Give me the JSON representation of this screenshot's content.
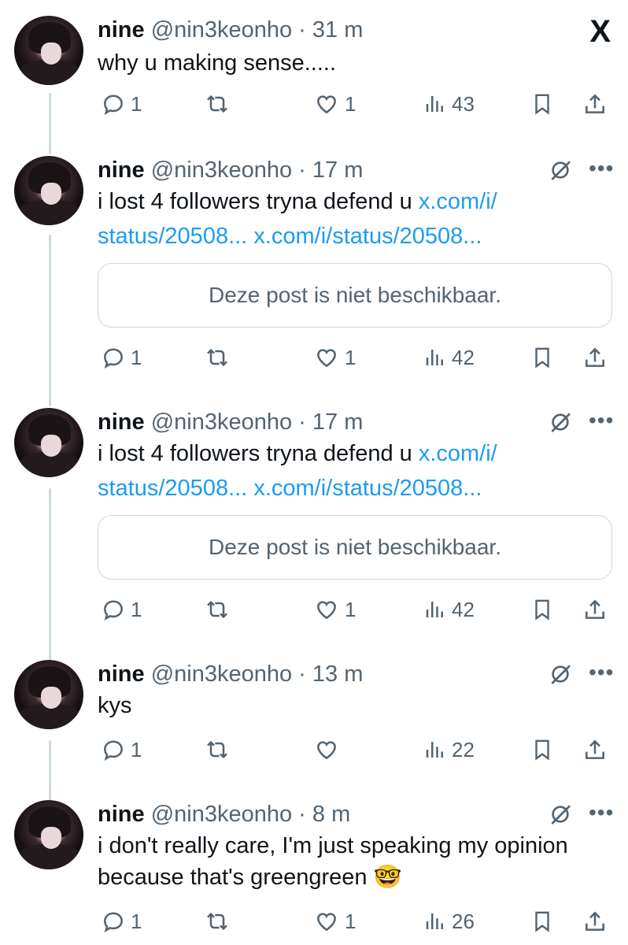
{
  "close_icon": "X",
  "author": {
    "name": "nine",
    "handle": "@nin3keonho"
  },
  "posts": [
    {
      "time": "31 m",
      "line1": "why u making sense.....",
      "replies": "1",
      "likes": "1",
      "views": "43"
    },
    {
      "time": "17 m",
      "line1_text": "i lost 4 followers tryna defend u ",
      "line1_link": "x.com/i/",
      "line2_link_a": "status/20508...",
      "line2_link_b": "x.com/i/status/20508...",
      "unavailable": "Deze post is niet beschikbaar.",
      "replies": "1",
      "likes": "1",
      "views": "42"
    },
    {
      "time": "17 m",
      "line1_text": "i lost 4 followers tryna defend u ",
      "line1_link": "x.com/i/",
      "line2_link_a": "status/20508...",
      "line2_link_b": "x.com/i/status/20508...",
      "unavailable": "Deze post is niet beschikbaar.",
      "replies": "1",
      "likes": "1",
      "views": "42"
    },
    {
      "time": "13 m",
      "line1": "kys",
      "replies": "1",
      "likes": "",
      "views": "22"
    },
    {
      "time": "8 m",
      "line1": "i don't really care, I'm just speaking my opinion",
      "line2": "because that's greengreen 🤓",
      "replies": "1",
      "likes": "1",
      "views": "26"
    }
  ]
}
